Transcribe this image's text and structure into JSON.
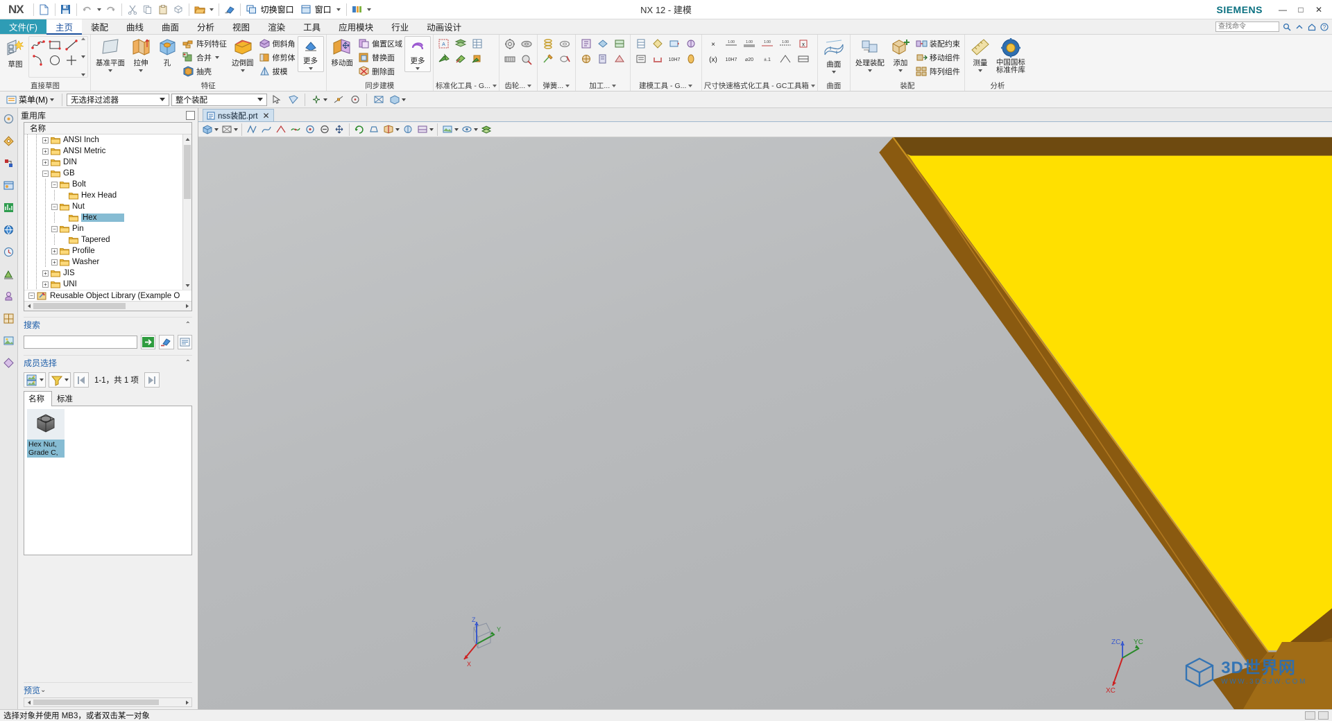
{
  "titlebar": {
    "logo": "NX",
    "title": "NX 12 - 建模",
    "brand": "SIEMENS",
    "quick_access": [
      {
        "name": "new-file",
        "label": "新建"
      },
      {
        "name": "save",
        "label": "保存"
      },
      {
        "name": "undo",
        "label": "撤销"
      },
      {
        "name": "redo",
        "label": "重做"
      },
      {
        "name": "cut",
        "label": "剪切"
      },
      {
        "name": "copy",
        "label": "复制"
      },
      {
        "name": "paste",
        "label": "粘贴"
      },
      {
        "name": "paste-special",
        "label": "选择性粘贴"
      },
      {
        "name": "open-folder",
        "label": "打开"
      },
      {
        "name": "eraser",
        "label": "擦除"
      }
    ],
    "switch_window_label": "切换窗口",
    "window_label": "窗口",
    "window_controls": {
      "minimize": "—",
      "maximize": "□",
      "close": "✕"
    }
  },
  "tabs": [
    {
      "label": "文件(F)",
      "kind": "file"
    },
    {
      "label": "主页",
      "kind": "active"
    },
    {
      "label": "装配",
      "kind": "normal"
    },
    {
      "label": "曲线",
      "kind": "normal"
    },
    {
      "label": "曲面",
      "kind": "normal"
    },
    {
      "label": "分析",
      "kind": "normal"
    },
    {
      "label": "视图",
      "kind": "normal"
    },
    {
      "label": "渲染",
      "kind": "normal"
    },
    {
      "label": "工具",
      "kind": "normal"
    },
    {
      "label": "应用模块",
      "kind": "normal"
    },
    {
      "label": "行业",
      "kind": "normal"
    },
    {
      "label": "动画设计",
      "kind": "normal"
    }
  ],
  "command_search": {
    "placeholder": "查找命令"
  },
  "ribbon": {
    "groups": [
      {
        "label": "直接草图",
        "big": [
          {
            "label": "草图",
            "icon": "sketch-icon"
          }
        ],
        "icons": [
          "studio-spline-icon",
          "rectangle-icon",
          "line-icon",
          "arc-icon",
          "circle-icon",
          "dimension-icon"
        ]
      },
      {
        "label": "特征",
        "big": [
          {
            "label": "基准平面",
            "icon": "datum-plane-icon",
            "caret": true
          },
          {
            "label": "拉伸",
            "icon": "extrude-icon",
            "caret": true
          },
          {
            "label": "孔",
            "icon": "hole-icon"
          }
        ],
        "small": [
          {
            "label": "阵列特征",
            "icon": "pattern-feature-icon"
          },
          {
            "label": "合并",
            "icon": "unite-icon",
            "caret": true
          },
          {
            "label": "抽壳",
            "icon": "shell-icon"
          }
        ],
        "big2": [
          {
            "label": "边倒圆",
            "icon": "edge-blend-icon",
            "caret": true
          }
        ],
        "small2": [
          {
            "label": "倒斜角",
            "icon": "chamfer-icon"
          },
          {
            "label": "修剪体",
            "icon": "trim-body-icon"
          },
          {
            "label": "拔模",
            "icon": "draft-icon"
          }
        ],
        "more": {
          "label": "更多",
          "icon": "more-feature-icon",
          "caret": true
        }
      },
      {
        "label": "同步建模",
        "big": [
          {
            "label": "移动面",
            "icon": "move-face-icon"
          }
        ],
        "small": [
          {
            "label": "偏置区域",
            "icon": "offset-region-icon"
          },
          {
            "label": "替换面",
            "icon": "replace-face-icon"
          },
          {
            "label": "删除面",
            "icon": "delete-face-icon"
          }
        ],
        "more": {
          "label": "更多",
          "icon": "more-sync-icon",
          "caret": true
        }
      },
      {
        "label": "标准化工具 - G...",
        "icons": [
          "attr-tool-icon",
          "layer-tool-icon",
          "part-list-icon",
          "gc-green-1-icon",
          "gc-green-2-icon",
          "gc-green-3-icon"
        ]
      },
      {
        "label": "齿轮...",
        "icons": [
          "spur-gear-icon",
          "bevel-gear-icon",
          "worm-gear-icon",
          "gear-modify-icon"
        ]
      },
      {
        "label": "弹簧...",
        "icons": [
          "cyl-spring-icon",
          "disc-spring-icon",
          "spring-edit-icon",
          "spring-del-icon"
        ]
      },
      {
        "label": "加工...",
        "icons": [
          "machining-1-icon",
          "machining-2-icon",
          "machining-3-icon",
          "machining-4-icon",
          "machining-5-icon",
          "machining-6-icon"
        ]
      },
      {
        "label": "建模工具 - G...",
        "icons": [
          "model-tool-1-icon",
          "model-tool-2-icon",
          "model-tool-3-icon",
          "model-tool-4-icon",
          "model-tool-5-icon",
          "model-tool-6-icon",
          "model-tool-7-icon",
          "model-tool-8-icon"
        ]
      },
      {
        "label": "尺寸快速格式化工具 - GC工具箱",
        "icons": [
          "dim-x-icon",
          "dim-100-a-icon",
          "dim-100-b-icon",
          "dim-100-c-icon",
          "dim-100-d-icon",
          "dim-box-x-icon",
          "dim-paren-x-icon",
          "dim-h7-icon",
          "dim-tol-1-icon",
          "dim-tol-2-icon",
          "dim-tol-3-icon",
          "dim-tol-4-icon"
        ]
      },
      {
        "label": "曲面",
        "big": [
          {
            "label": "曲面",
            "icon": "surface-icon",
            "caret": true
          }
        ]
      },
      {
        "label": "装配",
        "big": [
          {
            "label": "处理装配",
            "icon": "process-assembly-icon",
            "caret": true
          },
          {
            "label": "添加",
            "icon": "add-component-icon",
            "caret": true
          }
        ],
        "small": [
          {
            "label": "装配约束",
            "icon": "assembly-constraint-icon"
          },
          {
            "label": "移动组件",
            "icon": "move-component-icon"
          },
          {
            "label": "阵列组件",
            "icon": "pattern-component-icon"
          }
        ]
      },
      {
        "label": "分析",
        "big": [
          {
            "label": "测量",
            "icon": "measure-icon",
            "caret": true
          },
          {
            "label": "中国国标\n标准件库",
            "icon": "gb-library-icon"
          }
        ]
      }
    ]
  },
  "selection_bar": {
    "menu_label": "菜单(M)",
    "filter_value": "无选择过滤器",
    "scope_value": "整个装配",
    "icons": [
      "select-general-icon",
      "select-face-icon",
      "select-curve-icon",
      "snap-point-icon",
      "snap-dropdown-icon",
      "wireframe-icon",
      "shaded-icon"
    ]
  },
  "resource_bar": {
    "items": [
      {
        "name": "assembly-navigator-icon"
      },
      {
        "name": "constraint-navigator-icon"
      },
      {
        "name": "part-navigator-icon"
      },
      {
        "name": "reuse-library-icon"
      },
      {
        "name": "hd3d-tools-icon"
      },
      {
        "name": "web-browser-icon"
      },
      {
        "name": "history-icon"
      },
      {
        "name": "process-studio-icon"
      },
      {
        "name": "roles-icon"
      },
      {
        "name": "system-materials-icon"
      },
      {
        "name": "system-scenes-icon"
      },
      {
        "name": "system-visual-icon"
      }
    ]
  },
  "reuse_panel": {
    "title": "重用库",
    "tree_header": "名称",
    "tree": [
      {
        "label": "ANSI Inch",
        "indent": 2,
        "toggle": "+",
        "selected": false
      },
      {
        "label": "ANSI Metric",
        "indent": 2,
        "toggle": "+",
        "selected": false
      },
      {
        "label": "DIN",
        "indent": 2,
        "toggle": "+",
        "selected": false
      },
      {
        "label": "GB",
        "indent": 2,
        "toggle": "−",
        "selected": false
      },
      {
        "label": "Bolt",
        "indent": 3,
        "toggle": "−",
        "selected": false
      },
      {
        "label": "Hex Head",
        "indent": 4,
        "toggle": "",
        "selected": false
      },
      {
        "label": "Nut",
        "indent": 3,
        "toggle": "−",
        "selected": false
      },
      {
        "label": "Hex",
        "indent": 4,
        "toggle": "",
        "selected": true
      },
      {
        "label": "Pin",
        "indent": 3,
        "toggle": "−",
        "selected": false
      },
      {
        "label": "Tapered",
        "indent": 4,
        "toggle": "",
        "selected": false
      },
      {
        "label": "Profile",
        "indent": 3,
        "toggle": "+",
        "selected": false
      },
      {
        "label": "Washer",
        "indent": 3,
        "toggle": "+",
        "selected": false
      },
      {
        "label": "JIS",
        "indent": 2,
        "toggle": "+",
        "selected": false
      },
      {
        "label": "UNI",
        "indent": 2,
        "toggle": "+",
        "selected": false
      }
    ],
    "root_item": {
      "label": "Reusable Object Library (Example O",
      "toggle": "−"
    },
    "search": {
      "title": "搜索",
      "value": "",
      "buttons": [
        {
          "name": "search-go-button",
          "icon": "green-arrow-icon"
        },
        {
          "name": "search-clear-button",
          "icon": "eraser-icon"
        },
        {
          "name": "search-options-button",
          "icon": "list-options-icon"
        }
      ]
    },
    "member_select": {
      "title": "成员选择",
      "count_text": "1-1，共 1 项",
      "toolbar": [
        {
          "name": "view-mode-button",
          "icon": "thumbnail-icon",
          "caret": true
        },
        {
          "name": "filter-button",
          "icon": "funnel-icon",
          "caret": true
        },
        {
          "name": "first-page-button",
          "icon": "first-page-icon"
        },
        {
          "name": "last-page-button",
          "icon": "last-page-icon"
        }
      ],
      "tabs": [
        {
          "label": "名称",
          "active": true
        },
        {
          "label": "标准",
          "active": false
        }
      ],
      "members": [
        {
          "label": "Hex Nut,\nGrade C,",
          "icon": "hex-nut-icon",
          "selected": true
        }
      ]
    },
    "preview": {
      "title": "预览"
    }
  },
  "document_tabs": [
    {
      "label": "nss装配.prt",
      "close": "✕",
      "active": true
    }
  ],
  "view_toolbar": {
    "icons": [
      "shaded-view-icon",
      "wireframe-view-icon",
      "static-wireframe-icon",
      "studio-view-icon",
      "front-view-icon",
      "trimetric-view-icon",
      "zoom-fit-icon",
      "zoom-window-icon",
      "pan-icon",
      "rotate-icon",
      "perspective-icon",
      "section-icon",
      "display-mode-icon",
      "render-style-icon",
      "background-icon",
      "visibility-icon",
      "layer-settings-icon",
      "move-object-icon",
      "wcs-icon",
      "measure-quick-icon",
      "pmi-icon",
      "view-section-icon",
      "true-shading-icon"
    ]
  },
  "graphics": {
    "triad_labels": {
      "x": "X",
      "y": "Y",
      "z": "Z"
    },
    "wcs_labels": {
      "zc": "ZC",
      "yc": "YC",
      "xc": "XC"
    },
    "watermark": {
      "main": "3D世界网",
      "sub": "WWW.3DSJW.COM"
    },
    "colors": {
      "model_face_top": "#ffe000",
      "model_face_side": "#8a5a10",
      "model_face_edge": "#b07820",
      "background_top": "#c5c7c8",
      "background_bottom": "#adafb1"
    }
  },
  "status_bar": {
    "message": "选择对象并使用 MB3，或者双击某一对象"
  }
}
